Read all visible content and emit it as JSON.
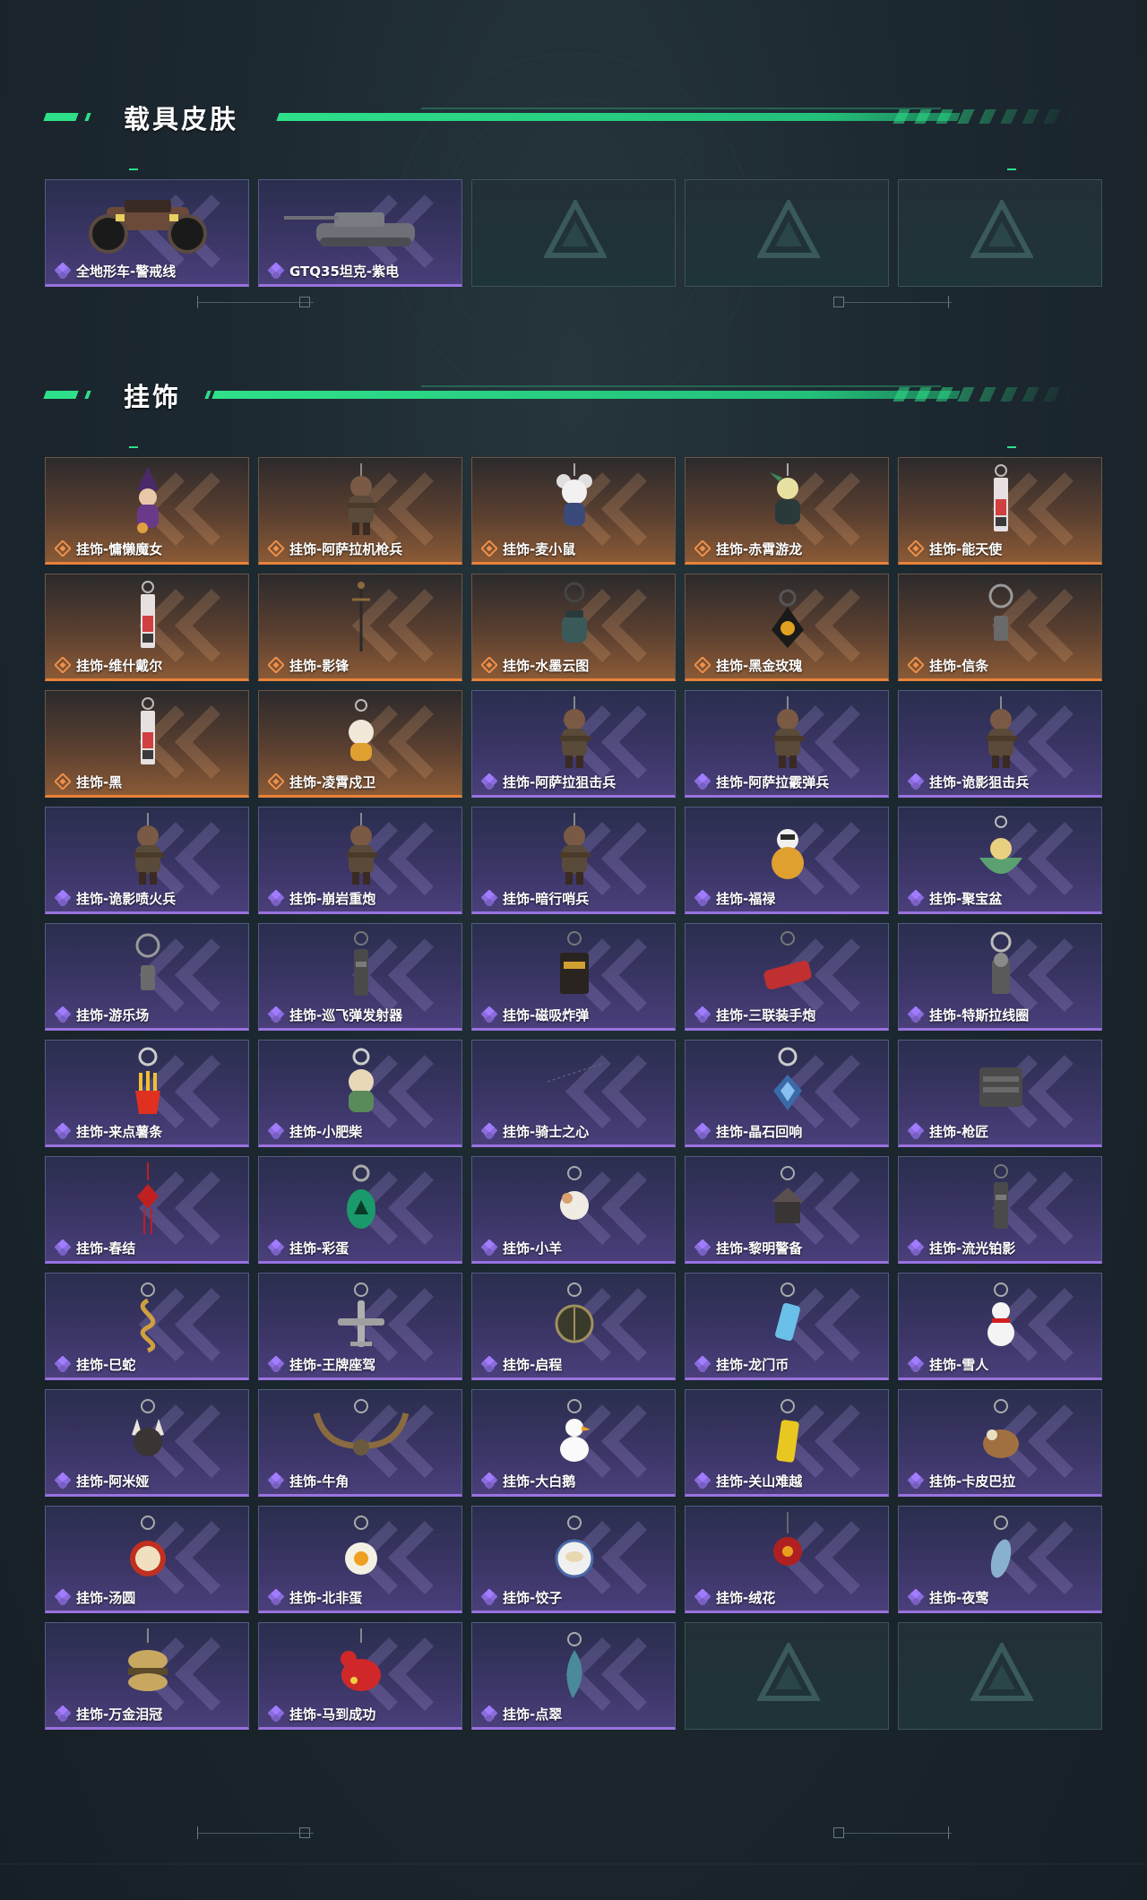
{
  "sections": {
    "vehicles": {
      "title": "载具皮肤",
      "items": [
        {
          "label": "全地形车-警戒线",
          "rarity": "purple",
          "art": "atv"
        },
        {
          "label": "GTQ35坦克-紫电",
          "rarity": "purple",
          "art": "tank"
        },
        {
          "label": "",
          "rarity": "empty"
        },
        {
          "label": "",
          "rarity": "empty"
        },
        {
          "label": "",
          "rarity": "empty"
        }
      ]
    },
    "charms": {
      "title": "挂饰",
      "items": [
        {
          "label": "挂饰-慵懒魔女",
          "rarity": "orange",
          "art": "witch"
        },
        {
          "label": "挂饰-阿萨拉机枪兵",
          "rarity": "orange",
          "art": "soldier"
        },
        {
          "label": "挂饰-麦小鼠",
          "rarity": "orange",
          "art": "mouse"
        },
        {
          "label": "挂饰-赤霄游龙",
          "rarity": "orange",
          "art": "dragon"
        },
        {
          "label": "挂饰-能天使",
          "rarity": "orange",
          "art": "tag"
        },
        {
          "label": "挂饰-维什戴尔",
          "rarity": "orange",
          "art": "tag"
        },
        {
          "label": "挂饰-影锋",
          "rarity": "orange",
          "art": "blade"
        },
        {
          "label": "挂饰-水墨云图",
          "rarity": "orange",
          "art": "pot"
        },
        {
          "label": "挂饰-黑金玫瑰",
          "rarity": "orange",
          "art": "rose"
        },
        {
          "label": "挂饰-信条",
          "rarity": "orange",
          "art": "ring"
        },
        {
          "label": "挂饰-黑",
          "rarity": "orange",
          "art": "tag"
        },
        {
          "label": "挂饰-凌霄戍卫",
          "rarity": "orange",
          "art": "chick"
        },
        {
          "label": "挂饰-阿萨拉狙击兵",
          "rarity": "purple",
          "art": "soldier"
        },
        {
          "label": "挂饰-阿萨拉霰弹兵",
          "rarity": "purple",
          "art": "soldier"
        },
        {
          "label": "挂饰-诡影狙击兵",
          "rarity": "purple",
          "art": "soldier"
        },
        {
          "label": "挂饰-诡影喷火兵",
          "rarity": "purple",
          "art": "soldier"
        },
        {
          "label": "挂饰-崩岩重炮",
          "rarity": "purple",
          "art": "soldier"
        },
        {
          "label": "挂饰-暗行哨兵",
          "rarity": "purple",
          "art": "soldier"
        },
        {
          "label": "挂饰-福禄",
          "rarity": "purple",
          "art": "gourd"
        },
        {
          "label": "挂饰-聚宝盆",
          "rarity": "purple",
          "art": "bowl"
        },
        {
          "label": "挂饰-游乐场",
          "rarity": "purple",
          "art": "ring"
        },
        {
          "label": "挂饰-巡飞弹发射器",
          "rarity": "purple",
          "art": "tube"
        },
        {
          "label": "挂饰-磁吸炸弹",
          "rarity": "purple",
          "art": "bomb"
        },
        {
          "label": "挂饰-三联装手炮",
          "rarity": "purple",
          "art": "cannon"
        },
        {
          "label": "挂饰-特斯拉线圈",
          "rarity": "purple",
          "art": "coil"
        },
        {
          "label": "挂饰-来点薯条",
          "rarity": "purple",
          "art": "fries"
        },
        {
          "label": "挂饰-小肥柴",
          "rarity": "purple",
          "art": "dog"
        },
        {
          "label": "挂饰-骑士之心",
          "rarity": "purple",
          "art": "none"
        },
        {
          "label": "挂饰-晶石回响",
          "rarity": "purple",
          "art": "gem"
        },
        {
          "label": "挂饰-枪匠",
          "rarity": "purple",
          "art": "box"
        },
        {
          "label": "挂饰-春结",
          "rarity": "purple",
          "art": "knot"
        },
        {
          "label": "挂饰-彩蛋",
          "rarity": "purple",
          "art": "egg"
        },
        {
          "label": "挂饰-小羊",
          "rarity": "purple",
          "art": "sheep"
        },
        {
          "label": "挂饰-黎明警备",
          "rarity": "purple",
          "art": "house"
        },
        {
          "label": "挂饰-流光铂影",
          "rarity": "purple",
          "art": "tube"
        },
        {
          "label": "挂饰-巳蛇",
          "rarity": "purple",
          "art": "snake"
        },
        {
          "label": "挂饰-王牌座驾",
          "rarity": "purple",
          "art": "plane"
        },
        {
          "label": "挂饰-启程",
          "rarity": "purple",
          "art": "medal"
        },
        {
          "label": "挂饰-龙门币",
          "rarity": "purple",
          "art": "can"
        },
        {
          "label": "挂饰-雪人",
          "rarity": "purple",
          "art": "snowman"
        },
        {
          "label": "挂饰-阿米娅",
          "rarity": "purple",
          "art": "bunny"
        },
        {
          "label": "挂饰-牛角",
          "rarity": "purple",
          "art": "horns"
        },
        {
          "label": "挂饰-大白鹅",
          "rarity": "purple",
          "art": "goose"
        },
        {
          "label": "挂饰-关山难越",
          "rarity": "purple",
          "art": "bar"
        },
        {
          "label": "挂饰-卡皮巴拉",
          "rarity": "purple",
          "art": "capy"
        },
        {
          "label": "挂饰-汤圆",
          "rarity": "purple",
          "art": "bowlred"
        },
        {
          "label": "挂饰-北非蛋",
          "rarity": "purple",
          "art": "egg2"
        },
        {
          "label": "挂饰-饺子",
          "rarity": "purple",
          "art": "plate"
        },
        {
          "label": "挂饰-绒花",
          "rarity": "purple",
          "art": "flower"
        },
        {
          "label": "挂饰-夜莺",
          "rarity": "purple",
          "art": "bird"
        },
        {
          "label": "挂饰-万金泪冠",
          "rarity": "purple",
          "art": "burger"
        },
        {
          "label": "挂饰-马到成功",
          "rarity": "purple",
          "art": "horse"
        },
        {
          "label": "挂饰-点翠",
          "rarity": "purple",
          "art": "feather"
        },
        {
          "label": "",
          "rarity": "empty"
        },
        {
          "label": "",
          "rarity": "empty"
        }
      ]
    }
  },
  "colors": {
    "accent_green": "#2ee08a",
    "rarity_purple": "#9a72e0",
    "rarity_orange": "#e8823a"
  }
}
